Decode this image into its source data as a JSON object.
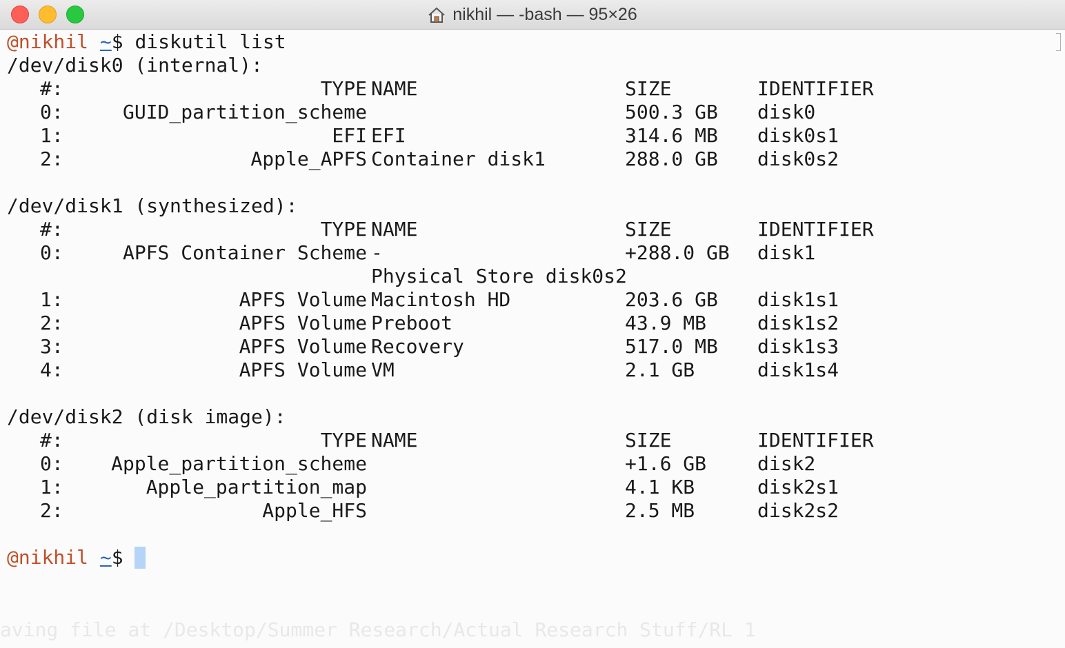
{
  "window": {
    "title": "nikhil — -bash — 95×26"
  },
  "prompt": {
    "user": "@nikhil",
    "tilde": "~",
    "symbol": "$"
  },
  "command": "diskutil list",
  "header": {
    "num": "#:",
    "type": "TYPE",
    "name": "NAME",
    "size": "SIZE",
    "identifier": "IDENTIFIER"
  },
  "disks": [
    {
      "title": "/dev/disk0 (internal):",
      "rows": [
        {
          "num": "0:",
          "type": "GUID_partition_scheme",
          "name": "",
          "size": "500.3 GB",
          "id": "disk0"
        },
        {
          "num": "1:",
          "type": "EFI",
          "name": "EFI",
          "size": "314.6 MB",
          "id": "disk0s1"
        },
        {
          "num": "2:",
          "type": "Apple_APFS",
          "name": "Container disk1",
          "size": "288.0 GB",
          "id": "disk0s2"
        }
      ]
    },
    {
      "title": "/dev/disk1 (synthesized):",
      "rows": [
        {
          "num": "0:",
          "type": "APFS Container Scheme",
          "name": "-",
          "size": "+288.0 GB",
          "id": "disk1"
        },
        {
          "num": "",
          "type": "",
          "name": "Physical Store disk0s2",
          "size": "",
          "id": ""
        },
        {
          "num": "1:",
          "type": "APFS Volume",
          "name": "Macintosh HD",
          "size": "203.6 GB",
          "id": "disk1s1"
        },
        {
          "num": "2:",
          "type": "APFS Volume",
          "name": "Preboot",
          "size": "43.9 MB",
          "id": "disk1s2"
        },
        {
          "num": "3:",
          "type": "APFS Volume",
          "name": "Recovery",
          "size": "517.0 MB",
          "id": "disk1s3"
        },
        {
          "num": "4:",
          "type": "APFS Volume",
          "name": "VM",
          "size": "2.1 GB",
          "id": "disk1s4"
        }
      ]
    },
    {
      "title": "/dev/disk2 (disk image):",
      "rows": [
        {
          "num": "0:",
          "type": "Apple_partition_scheme",
          "name": "",
          "size": "+1.6 GB",
          "id": "disk2"
        },
        {
          "num": "1:",
          "type": "Apple_partition_map",
          "name": "",
          "size": "4.1 KB",
          "id": "disk2s1"
        },
        {
          "num": "2:",
          "type": "Apple_HFS",
          "name": "",
          "size": "2.5 MB",
          "id": "disk2s2"
        }
      ]
    }
  ],
  "background_text": "aving file at /Desktop/Summer Research/Actual Research Stuff/RL 1",
  "colors": {
    "prompt_user": "#c0502a",
    "prompt_tilde": "#2a64b8",
    "cursor": "#b6d4f7"
  }
}
